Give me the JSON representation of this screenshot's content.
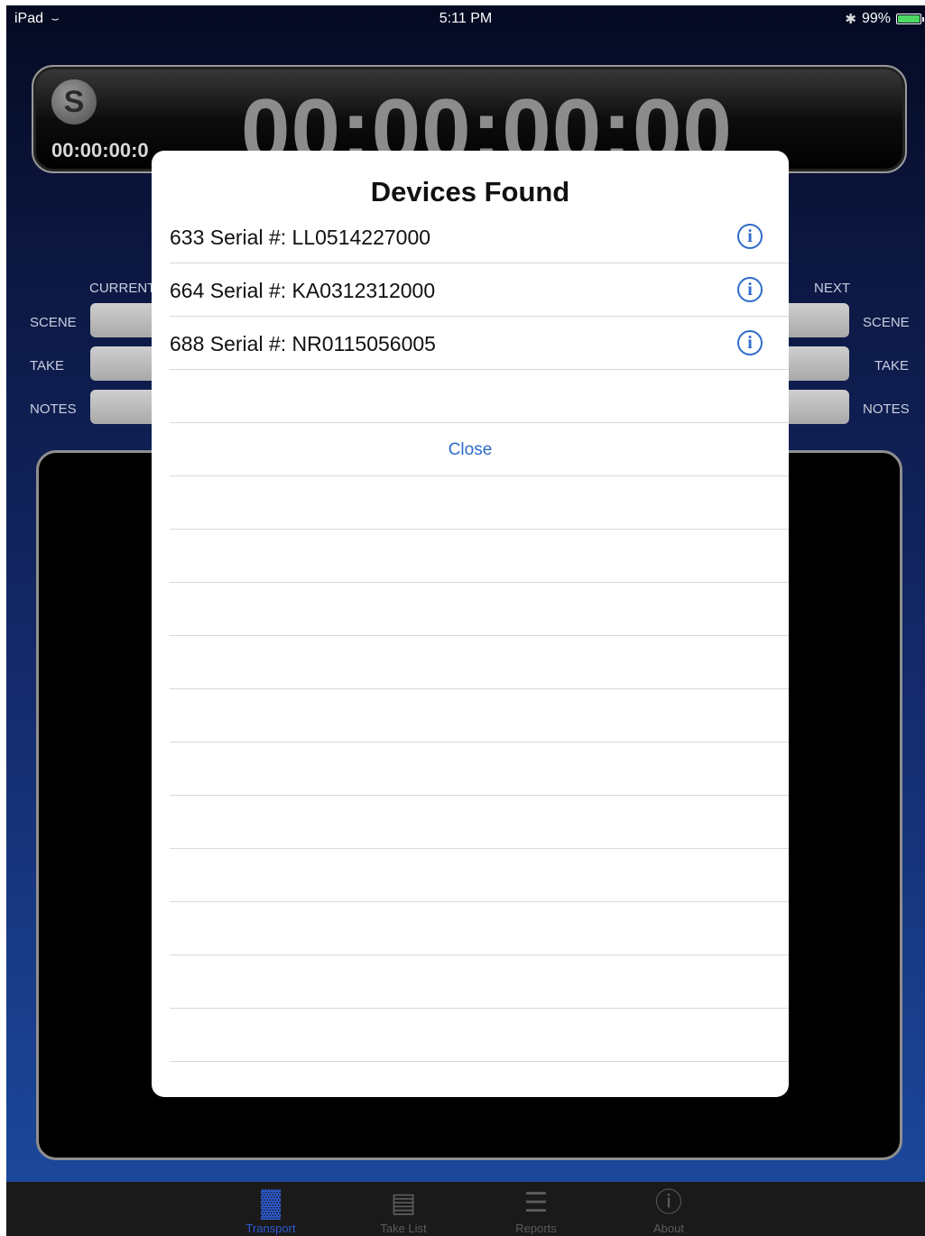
{
  "status_bar": {
    "device": "iPad",
    "time": "5:11 PM",
    "battery": "99%",
    "battery_level": 0.99
  },
  "timecode": {
    "small": "00:00:00:0",
    "large": "00:00:00:00"
  },
  "metadata": {
    "current_header": "CURRENT",
    "next_header": "NEXT",
    "left_labels": [
      "SCENE",
      "TAKE",
      "NOTES"
    ],
    "right_labels": [
      "SCENE",
      "TAKE",
      "NOTES"
    ]
  },
  "modal": {
    "title": "Devices Found",
    "devices": [
      {
        "label": "633 Serial #: LL0514227000"
      },
      {
        "label": "664 Serial #: KA0312312000"
      },
      {
        "label": "688 Serial #: NR0115056005"
      }
    ],
    "close_label": "Close"
  },
  "tabbar": {
    "tabs": [
      {
        "label": "Transport",
        "icon": "transport-bars-icon",
        "active": true
      },
      {
        "label": "Take List",
        "icon": "clapperboard-icon",
        "active": false
      },
      {
        "label": "Reports",
        "icon": "document-icon",
        "active": false
      },
      {
        "label": "About",
        "icon": "info-icon",
        "active": false
      }
    ]
  },
  "colors": {
    "accent": "#2f6cc9",
    "tab_active": "#2e5bd4"
  }
}
